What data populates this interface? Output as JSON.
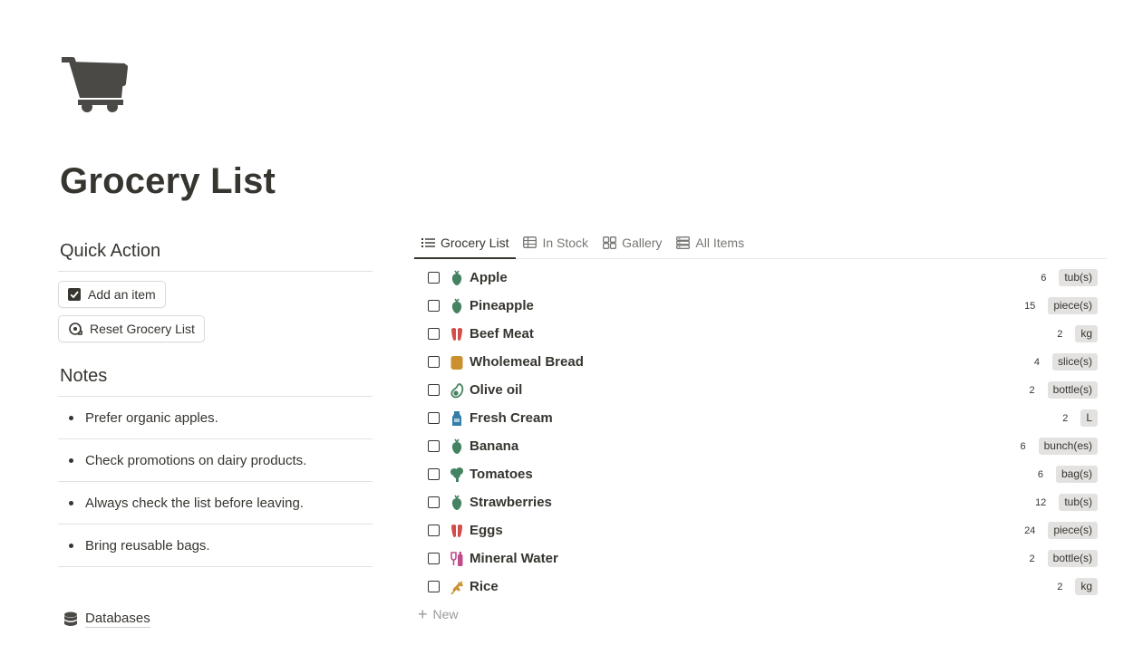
{
  "page": {
    "title": "Grocery List",
    "icon": "shopping-cart-icon"
  },
  "quick_action": {
    "heading": "Quick Action",
    "add_item_label": "Add an item",
    "reset_label": "Reset Grocery List"
  },
  "notes": {
    "heading": "Notes",
    "items": [
      "Prefer organic apples.",
      "Check promotions on dairy products.",
      "Always check the list before leaving.",
      "Bring reusable bags."
    ]
  },
  "databases_link": "Databases",
  "tabs": [
    {
      "label": "Grocery List",
      "icon": "list-icon",
      "active": true
    },
    {
      "label": "In Stock",
      "icon": "table-icon",
      "active": false
    },
    {
      "label": "Gallery",
      "icon": "gallery-icon",
      "active": false
    },
    {
      "label": "All Items",
      "icon": "database-icon",
      "active": false
    }
  ],
  "items": [
    {
      "name": "Apple",
      "qty": "6",
      "unit": "tub(s)",
      "icon": "produce-icon",
      "color": "#448361"
    },
    {
      "name": "Pineapple",
      "qty": "15",
      "unit": "piece(s)",
      "icon": "produce-icon",
      "color": "#448361"
    },
    {
      "name": "Beef Meat",
      "qty": "2",
      "unit": "kg",
      "icon": "meat-icon",
      "color": "#d44c47"
    },
    {
      "name": "Wholemeal Bread",
      "qty": "4",
      "unit": "slice(s)",
      "icon": "bread-icon",
      "color": "#cb912f"
    },
    {
      "name": "Olive oil",
      "qty": "2",
      "unit": "bottle(s)",
      "icon": "avocado-icon",
      "color": "#448361"
    },
    {
      "name": "Fresh Cream",
      "qty": "2",
      "unit": "L",
      "icon": "milk-carton-icon",
      "color": "#337ea9"
    },
    {
      "name": "Banana",
      "qty": "6",
      "unit": "bunch(es)",
      "icon": "produce-icon",
      "color": "#448361"
    },
    {
      "name": "Tomatoes",
      "qty": "6",
      "unit": "bag(s)",
      "icon": "broccoli-icon",
      "color": "#448361"
    },
    {
      "name": "Strawberries",
      "qty": "12",
      "unit": "tub(s)",
      "icon": "produce-icon",
      "color": "#448361"
    },
    {
      "name": "Eggs",
      "qty": "24",
      "unit": "piece(s)",
      "icon": "meat-icon",
      "color": "#d44c47"
    },
    {
      "name": "Mineral Water",
      "qty": "2",
      "unit": "bottle(s)",
      "icon": "wine-icon",
      "color": "#c14c8a"
    },
    {
      "name": "Rice",
      "qty": "2",
      "unit": "kg",
      "icon": "grain-icon",
      "color": "#cb912f"
    }
  ],
  "new_label": "New",
  "colors": {
    "text": "#37352f",
    "muted": "#787774",
    "tag_bg": "#e3e2e0",
    "divider": "#e2e1de"
  }
}
